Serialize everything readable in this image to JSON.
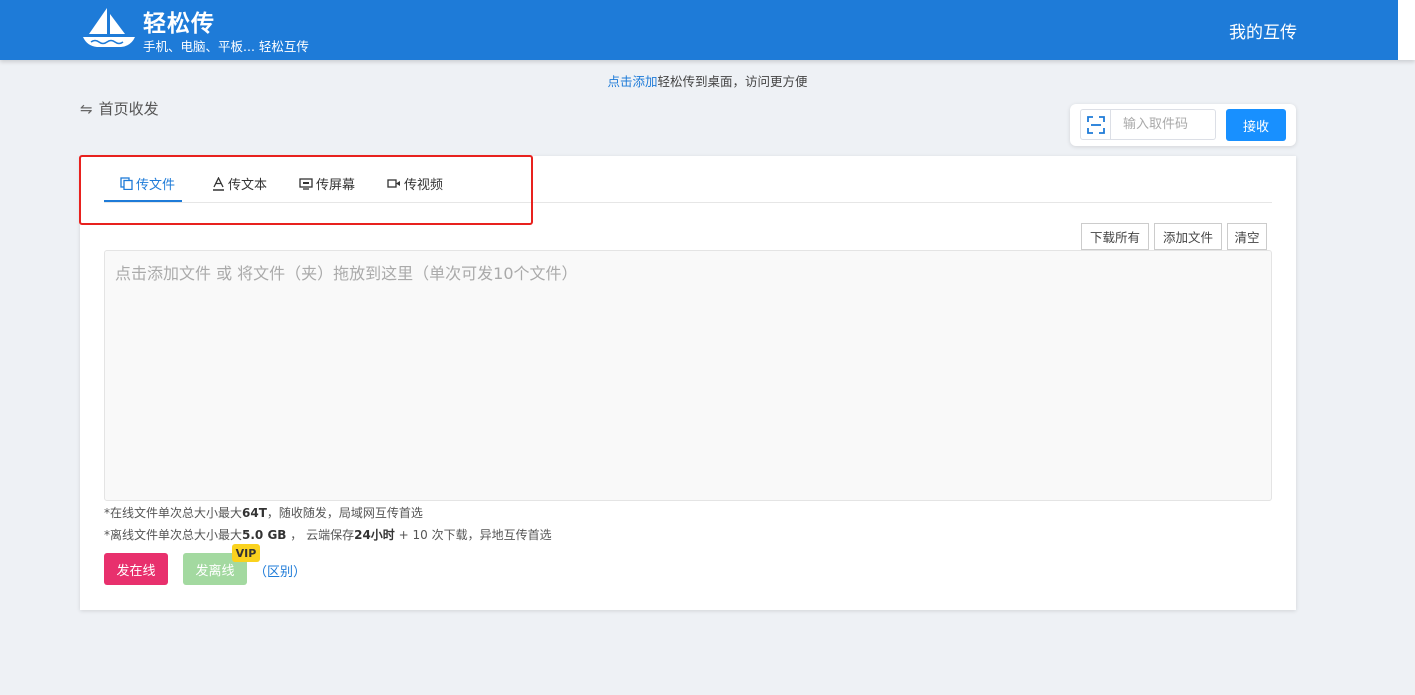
{
  "header": {
    "title": "轻松传",
    "subtitle": "手机、电脑、平板... 轻松互传",
    "my_link": "我的互传",
    "brand_color": "#1e7bd8"
  },
  "notice": {
    "link_text": "点击添加",
    "rest_text": "轻松传到桌面，访问更方便"
  },
  "breadcrumb": {
    "icon": "swap-arrows-icon",
    "label": "首页收发"
  },
  "receive": {
    "placeholder": "输入取件码",
    "button": "接收",
    "scan_icon": "scan-icon"
  },
  "tabs": [
    {
      "label": "传文件",
      "icon": "file-copy-icon",
      "active": true
    },
    {
      "label": "传文本",
      "icon": "text-icon",
      "active": false
    },
    {
      "label": "传屏幕",
      "icon": "screen-icon",
      "active": false
    },
    {
      "label": "传视频",
      "icon": "video-icon",
      "active": false
    }
  ],
  "toolbar": {
    "download_all": "下载所有",
    "add_file": "添加文件",
    "clear": "清空"
  },
  "drop_zone": {
    "text": "点击添加文件 或 将文件（夹）拖放到这里（单次可发10个文件）"
  },
  "info": {
    "line1_pre": "*在线文件单次总大小最大",
    "line1_bold": "64T",
    "line1_post": "，随收随发，局域网互传首选",
    "line2_pre": "*离线文件单次总大小最大",
    "line2_bold1": "5.0 GB",
    "line2_mid": " ， 云端保存",
    "line2_bold2": "24小时",
    "line2_post": " + 10 次下载，异地互传首选"
  },
  "actions": {
    "online": "发在线",
    "offline": "发离线",
    "vip": "VIP",
    "diff": "（区别）",
    "online_color": "#e8306d",
    "offline_color": "#a3d9a0"
  }
}
